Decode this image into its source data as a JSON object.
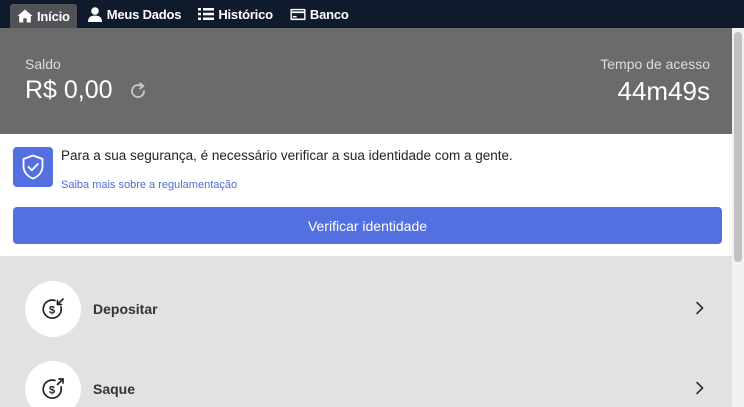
{
  "nav": {
    "tabs": [
      {
        "label": "Início",
        "icon": "home-icon",
        "active": true
      },
      {
        "label": "Meus Dados",
        "icon": "user-icon",
        "active": false
      },
      {
        "label": "Histórico",
        "icon": "list-icon",
        "active": false
      },
      {
        "label": "Banco",
        "icon": "card-icon",
        "active": false
      }
    ]
  },
  "balance": {
    "label": "Saldo",
    "value": "R$ 0,00",
    "time_label": "Tempo de acesso",
    "time_value": "44m49s"
  },
  "security": {
    "message": "Para a sua segurança, é necessário verificar a sua identidade com a gente.",
    "link": "Saiba mais sobre a regulamentação",
    "button": "Verificar identidade"
  },
  "actions": [
    {
      "label": "Depositar",
      "icon": "deposit-icon"
    },
    {
      "label": "Saque",
      "icon": "withdraw-icon"
    }
  ],
  "colors": {
    "nav_bg": "#101a2d",
    "accent": "#5470e0",
    "header_bg": "#6b6b6b"
  }
}
